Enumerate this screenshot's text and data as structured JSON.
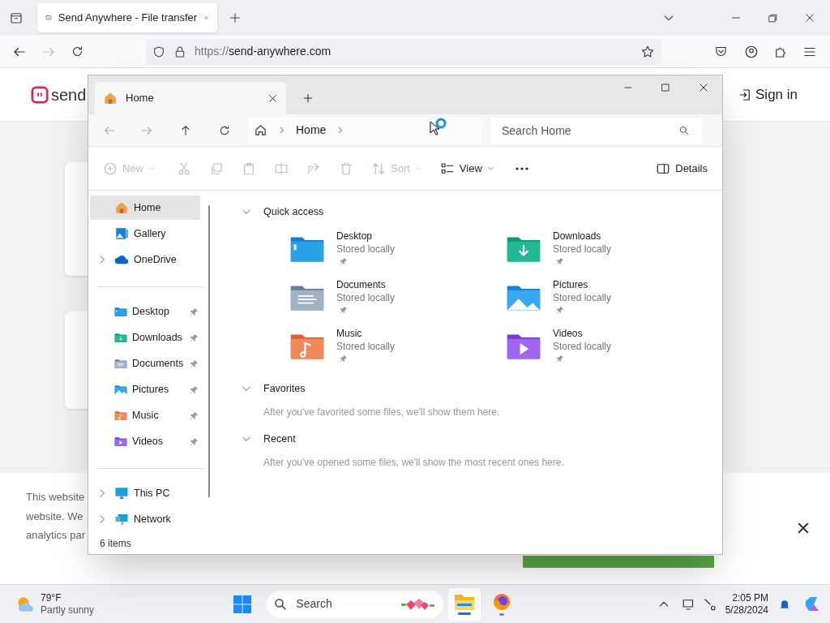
{
  "browser": {
    "tabs": [
      {
        "title": "Send Anywhere - File transfer",
        "selected": true
      }
    ],
    "url_scheme": "https://",
    "url_host": "send-anywhere.com"
  },
  "page": {
    "logo_text": "send",
    "sign_in": "Sign in",
    "cookie_lines": [
      "This website",
      "website. We",
      "analytics par"
    ]
  },
  "explorer": {
    "tab_title": "Home",
    "breadcrumb": [
      "Home"
    ],
    "search_placeholder": "Search Home",
    "toolbar": [
      {
        "kind": "new",
        "label": "New",
        "disabled": true
      },
      {
        "kind": "cut",
        "disabled": true
      },
      {
        "kind": "copy",
        "disabled": true
      },
      {
        "kind": "paste",
        "disabled": true
      },
      {
        "kind": "rename",
        "disabled": true
      },
      {
        "kind": "share",
        "disabled": true
      },
      {
        "kind": "delete",
        "disabled": true
      },
      {
        "kind": "sort",
        "label": "Sort",
        "disabled": true
      },
      {
        "kind": "view",
        "label": "View",
        "disabled": false
      },
      {
        "kind": "more",
        "disabled": false
      },
      {
        "kind": "details",
        "label": "Details",
        "disabled": false
      }
    ],
    "sidebar_groups": [
      [
        {
          "kind": "home",
          "label": "Home",
          "selected": true,
          "expandable": false,
          "pinned": false
        },
        {
          "kind": "gallery",
          "label": "Gallery",
          "selected": false,
          "expandable": false,
          "pinned": false
        },
        {
          "kind": "onedrive",
          "label": "OneDrive",
          "selected": false,
          "expandable": true,
          "pinned": false
        }
      ],
      [
        {
          "kind": "desktop",
          "label": "Desktop",
          "selected": false,
          "expandable": false,
          "pinned": true
        },
        {
          "kind": "downloads",
          "label": "Downloads",
          "selected": false,
          "expandable": false,
          "pinned": true
        },
        {
          "kind": "documents",
          "label": "Documents",
          "selected": false,
          "expandable": false,
          "pinned": true
        },
        {
          "kind": "pictures",
          "label": "Pictures",
          "selected": false,
          "expandable": false,
          "pinned": true
        },
        {
          "kind": "music",
          "label": "Music",
          "selected": false,
          "expandable": false,
          "pinned": true
        },
        {
          "kind": "videos",
          "label": "Videos",
          "selected": false,
          "expandable": false,
          "pinned": true
        }
      ],
      [
        {
          "kind": "pc",
          "label": "This PC",
          "selected": false,
          "expandable": true,
          "pinned": false
        },
        {
          "kind": "network",
          "label": "Network",
          "selected": false,
          "expandable": true,
          "pinned": false
        }
      ]
    ],
    "quick_access": {
      "title": "Quick access",
      "expanded": true,
      "folders": [
        {
          "kind": "desktop",
          "name": "Desktop",
          "status": "Stored locally",
          "pinned": true
        },
        {
          "kind": "downloads",
          "name": "Downloads",
          "status": "Stored locally",
          "pinned": true
        },
        {
          "kind": "documents",
          "name": "Documents",
          "status": "Stored locally",
          "pinned": true
        },
        {
          "kind": "pictures",
          "name": "Pictures",
          "status": "Stored locally",
          "pinned": true
        },
        {
          "kind": "music",
          "name": "Music",
          "status": "Stored locally",
          "pinned": true
        },
        {
          "kind": "videos",
          "name": "Videos",
          "status": "Stored locally",
          "pinned": true
        }
      ]
    },
    "sections": [
      {
        "title": "Favorites",
        "expanded": true,
        "message": "After you've favorited some files, we'll show them here."
      },
      {
        "title": "Recent",
        "expanded": true,
        "message": "After you've opened some files, we'll show the most recent ones here."
      }
    ],
    "status": "6 items"
  },
  "taskbar": {
    "temperature": "79°F",
    "condition": "Partly sunny",
    "search": "Search",
    "apps": [
      {
        "kind": "explorer",
        "selected": true
      },
      {
        "kind": "firefox",
        "selected": false
      }
    ],
    "time": "2:05 PM",
    "date": "5/28/2024"
  }
}
